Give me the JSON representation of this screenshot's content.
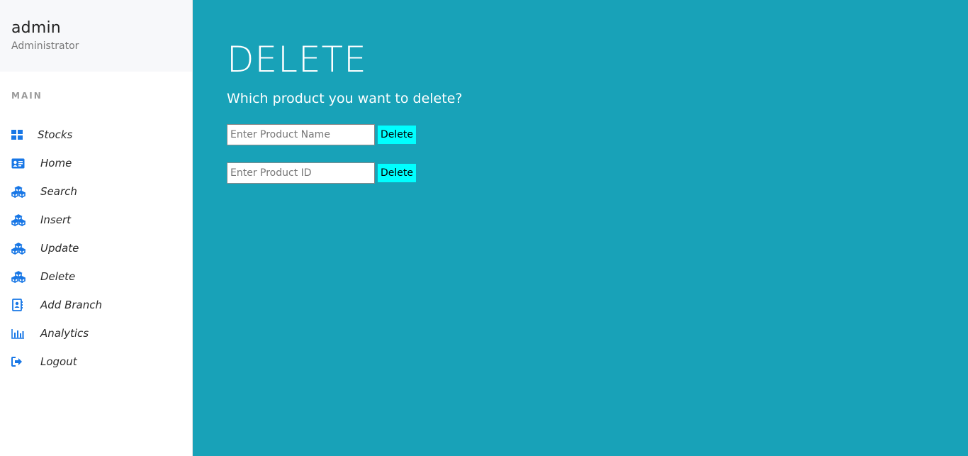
{
  "profile": {
    "name": "admin",
    "role": "Administrator"
  },
  "sidebar": {
    "section_label": "MAIN",
    "items": [
      {
        "label": "Stocks",
        "icon": "grid-icon"
      },
      {
        "label": "Home",
        "icon": "id-card-icon"
      },
      {
        "label": "Search",
        "icon": "cubes-icon"
      },
      {
        "label": "Insert",
        "icon": "cubes-icon"
      },
      {
        "label": "Update",
        "icon": "cubes-icon"
      },
      {
        "label": "Delete",
        "icon": "cubes-icon"
      },
      {
        "label": "Add Branch",
        "icon": "address-book-icon"
      },
      {
        "label": "Analytics",
        "icon": "bar-chart-icon"
      },
      {
        "label": "Logout",
        "icon": "sign-out-icon"
      }
    ]
  },
  "main": {
    "title": "DELETE",
    "subtitle": "Which product you want to delete?",
    "name_form": {
      "placeholder": "Enter Product Name",
      "value": "",
      "button_label": "Delete"
    },
    "id_form": {
      "placeholder": "Enter Product ID",
      "value": "",
      "button_label": "Delete"
    }
  },
  "colors": {
    "main_background": "#18a2b8",
    "button_background": "#00ffff",
    "icon_color": "#1877e6",
    "profile_background": "#f7f8fa"
  }
}
